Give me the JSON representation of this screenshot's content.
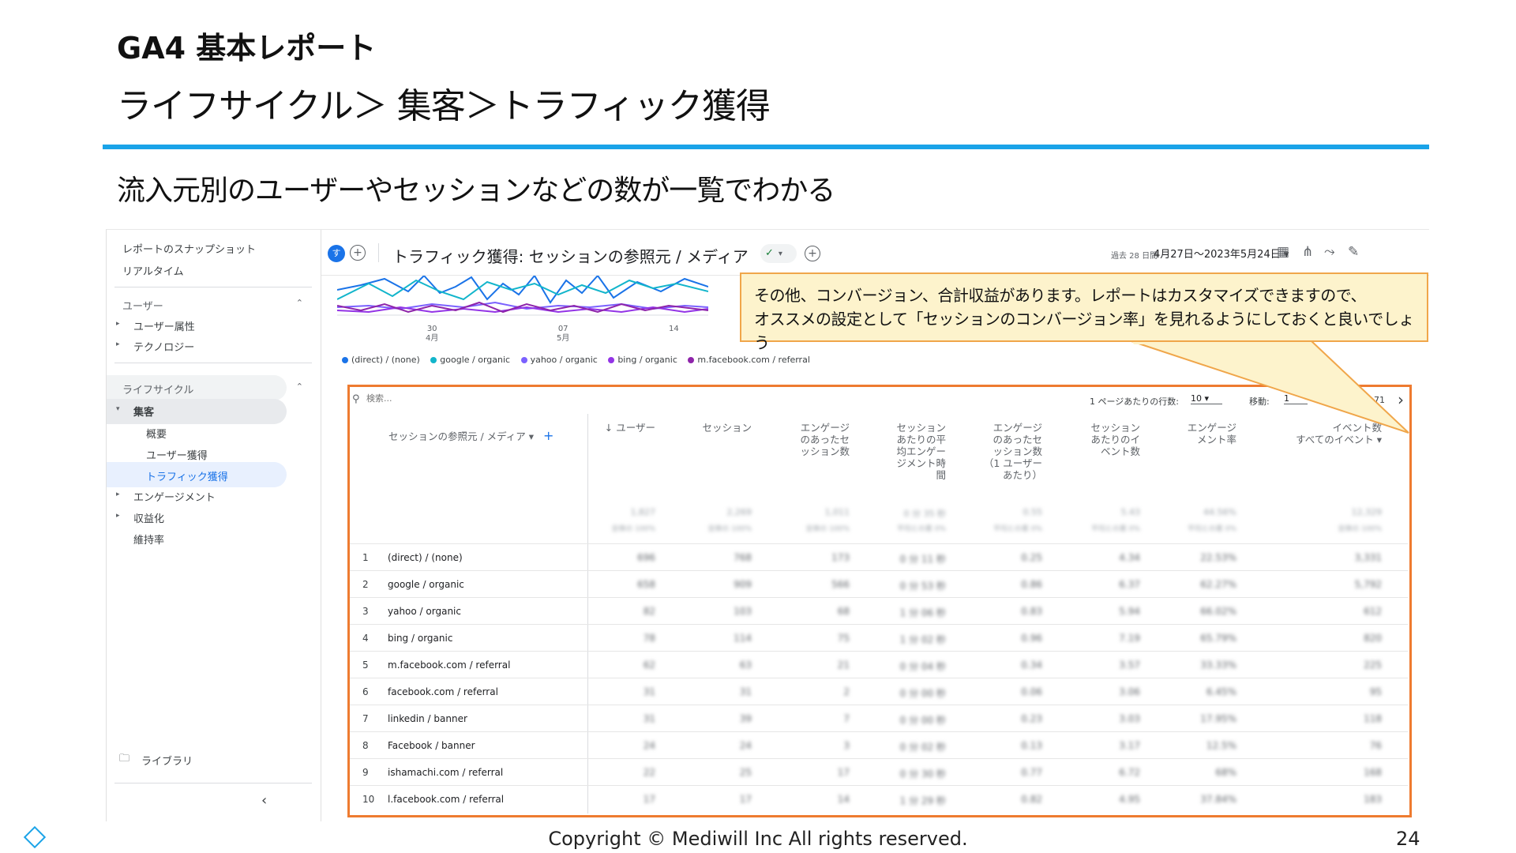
{
  "slide": {
    "title": "GA4 基本レポート",
    "subtitle": "ライフサイクル＞ 集客＞トラフィック獲得",
    "lead": "流入元別のユーザーやセッションなどの数が一覧でわかる",
    "copyright": "Copyright © Mediwill Inc All rights reserved.",
    "page_number": "24",
    "accent_color": "#1aa3e8",
    "highlight_color": "#ee7b30"
  },
  "sidebar": {
    "snapshot": "レポートのスナップショット",
    "realtime": "リアルタイム",
    "user_section": "ユーザー",
    "user_attributes": "ユーザー属性",
    "technology": "テクノロジー",
    "lifecycle_section": "ライフサイクル",
    "acquisition": "集客",
    "overview": "概要",
    "user_acquisition": "ユーザー獲得",
    "traffic_acquisition": "トラフィック獲得",
    "engagement": "エンゲージメント",
    "monetization": "収益化",
    "retention": "維持率",
    "library": "ライブラリ"
  },
  "topbar": {
    "badge": "す",
    "report_title": "トラフィック獲得: セッションの参照元 / メディア",
    "date_label": "過去 28 日間",
    "date_range": "4月27日〜2023年5月24日"
  },
  "chart": {
    "ticks": [
      {
        "day": "30",
        "month": "4月"
      },
      {
        "day": "07",
        "month": "5月"
      },
      {
        "day": "14",
        "month": ""
      }
    ],
    "legend": [
      {
        "label": "(direct) / (none)",
        "color": "#1a73e8"
      },
      {
        "label": "google / organic",
        "color": "#12b5cb"
      },
      {
        "label": "yahoo / organic",
        "color": "#7b61ff"
      },
      {
        "label": "bing / organic",
        "color": "#9334e6"
      },
      {
        "label": "m.facebook.com / referral",
        "color": "#8e24aa"
      }
    ]
  },
  "callout": {
    "line1": "その他、コンバージョン、合計収益があります。レポートはカスタマイズできますので、",
    "line2": "オススメの設定として「セッションのコンバージョン率」を見れるようにしておくと良いでしょう"
  },
  "table": {
    "search_placeholder": "検索...",
    "rows_per_page_label": "1 ページあたりの行数:",
    "rows_per_page": "10",
    "goto_label": "移動:",
    "goto_value": "1",
    "pager_suffix": "71",
    "dimension_header": "セッションの参照元 / メディア",
    "columns": [
      {
        "label": "↓ ユーザー",
        "total": "1,827",
        "total_sub": "全体の 100%"
      },
      {
        "label": "セッション",
        "total": "2,269",
        "total_sub": "全体の 100%"
      },
      {
        "label": "エンゲージ\nのあったセ\nッション数",
        "total": "1,011",
        "total_sub": "全体の 100%"
      },
      {
        "label": "セッション\nあたりの平\n均エンゲー\nジメント時\n間",
        "total": "0 分 35 秒",
        "total_sub": "平均との差 0%"
      },
      {
        "label": "エンゲージ\nのあったセ\nッション数\n（1 ユーザー\nあたり）",
        "total": "0.55",
        "total_sub": "平均との差 0%"
      },
      {
        "label": "セッション\nあたりのイ\nベント数",
        "total": "5.43",
        "total_sub": "平均との差 0%"
      },
      {
        "label": "エンゲージ\nメント率",
        "total": "44.56%",
        "total_sub": "平均との差 0%"
      },
      {
        "label": "イベント数\nすべてのイベント ▾",
        "total": "12,329",
        "total_sub": "全体の 100%"
      }
    ],
    "rows": [
      {
        "n": "1",
        "source": "(direct) / (none)",
        "values": [
          "696",
          "768",
          "173",
          "0 分 11 秒",
          "0.25",
          "4.34",
          "22.53%",
          "3,331"
        ]
      },
      {
        "n": "2",
        "source": "google / organic",
        "values": [
          "658",
          "909",
          "566",
          "0 分 53 秒",
          "0.86",
          "6.37",
          "62.27%",
          "5,792"
        ]
      },
      {
        "n": "3",
        "source": "yahoo / organic",
        "values": [
          "82",
          "103",
          "68",
          "1 分 06 秒",
          "0.83",
          "5.94",
          "66.02%",
          "612"
        ]
      },
      {
        "n": "4",
        "source": "bing / organic",
        "values": [
          "78",
          "114",
          "75",
          "1 分 02 秒",
          "0.96",
          "7.19",
          "65.79%",
          "820"
        ]
      },
      {
        "n": "5",
        "source": "m.facebook.com / referral",
        "values": [
          "62",
          "63",
          "21",
          "0 分 04 秒",
          "0.34",
          "3.57",
          "33.33%",
          "225"
        ]
      },
      {
        "n": "6",
        "source": "facebook.com / referral",
        "values": [
          "31",
          "31",
          "2",
          "0 分 00 秒",
          "0.06",
          "3.06",
          "6.45%",
          "95"
        ]
      },
      {
        "n": "7",
        "source": "linkedin / banner",
        "values": [
          "31",
          "39",
          "7",
          "0 分 00 秒",
          "0.23",
          "3.03",
          "17.95%",
          "118"
        ]
      },
      {
        "n": "8",
        "source": "Facebook / banner",
        "values": [
          "24",
          "24",
          "3",
          "0 分 02 秒",
          "0.13",
          "3.17",
          "12.5%",
          "76"
        ]
      },
      {
        "n": "9",
        "source": "ishamachi.com / referral",
        "values": [
          "22",
          "25",
          "17",
          "0 分 30 秒",
          "0.77",
          "6.72",
          "68%",
          "168"
        ]
      },
      {
        "n": "10",
        "source": "l.facebook.com / referral",
        "values": [
          "17",
          "17",
          "14",
          "1 分 29 秒",
          "0.82",
          "4.95",
          "37.84%",
          "183"
        ]
      }
    ]
  }
}
